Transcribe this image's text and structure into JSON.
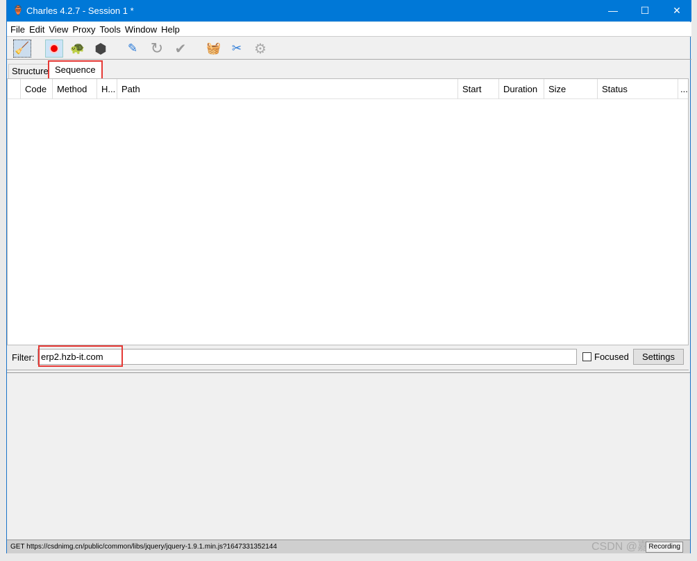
{
  "window": {
    "title": "Charles 4.2.7 - Session 1 *",
    "minimize": "—",
    "maximize": "☐",
    "close": "✕"
  },
  "menu": [
    "File",
    "Edit",
    "View",
    "Proxy",
    "Tools",
    "Window",
    "Help"
  ],
  "toolbar": [
    "broom-icon",
    "record-icon",
    "throttle-turtle-icon",
    "stop-breakpoints-icon",
    "compose-pen-icon",
    "repeat-icon",
    "validate-check-icon",
    "basket-icon",
    "tools-icon",
    "settings-gear-icon"
  ],
  "tabs": {
    "structure": "Structure",
    "sequence": "Sequence"
  },
  "columns": [
    "Code",
    "Method",
    "H...",
    "Path",
    "Start",
    "Duration",
    "Size",
    "Status",
    "..."
  ],
  "filter": {
    "label": "Filter:",
    "value": "erp2.hzb-it.com",
    "focused_label": "Focused",
    "focused_checked": false,
    "settings": "Settings"
  },
  "status": {
    "text": "GET https://csdnimg.cn/public/common/libs/jquery/jquery-1.9.1.min.js?1647331352144",
    "recording": "Recording",
    "watermark": "CSDN @嘉"
  },
  "colors": {
    "titlebar": "#0078d7",
    "highlight": "#e53935"
  }
}
